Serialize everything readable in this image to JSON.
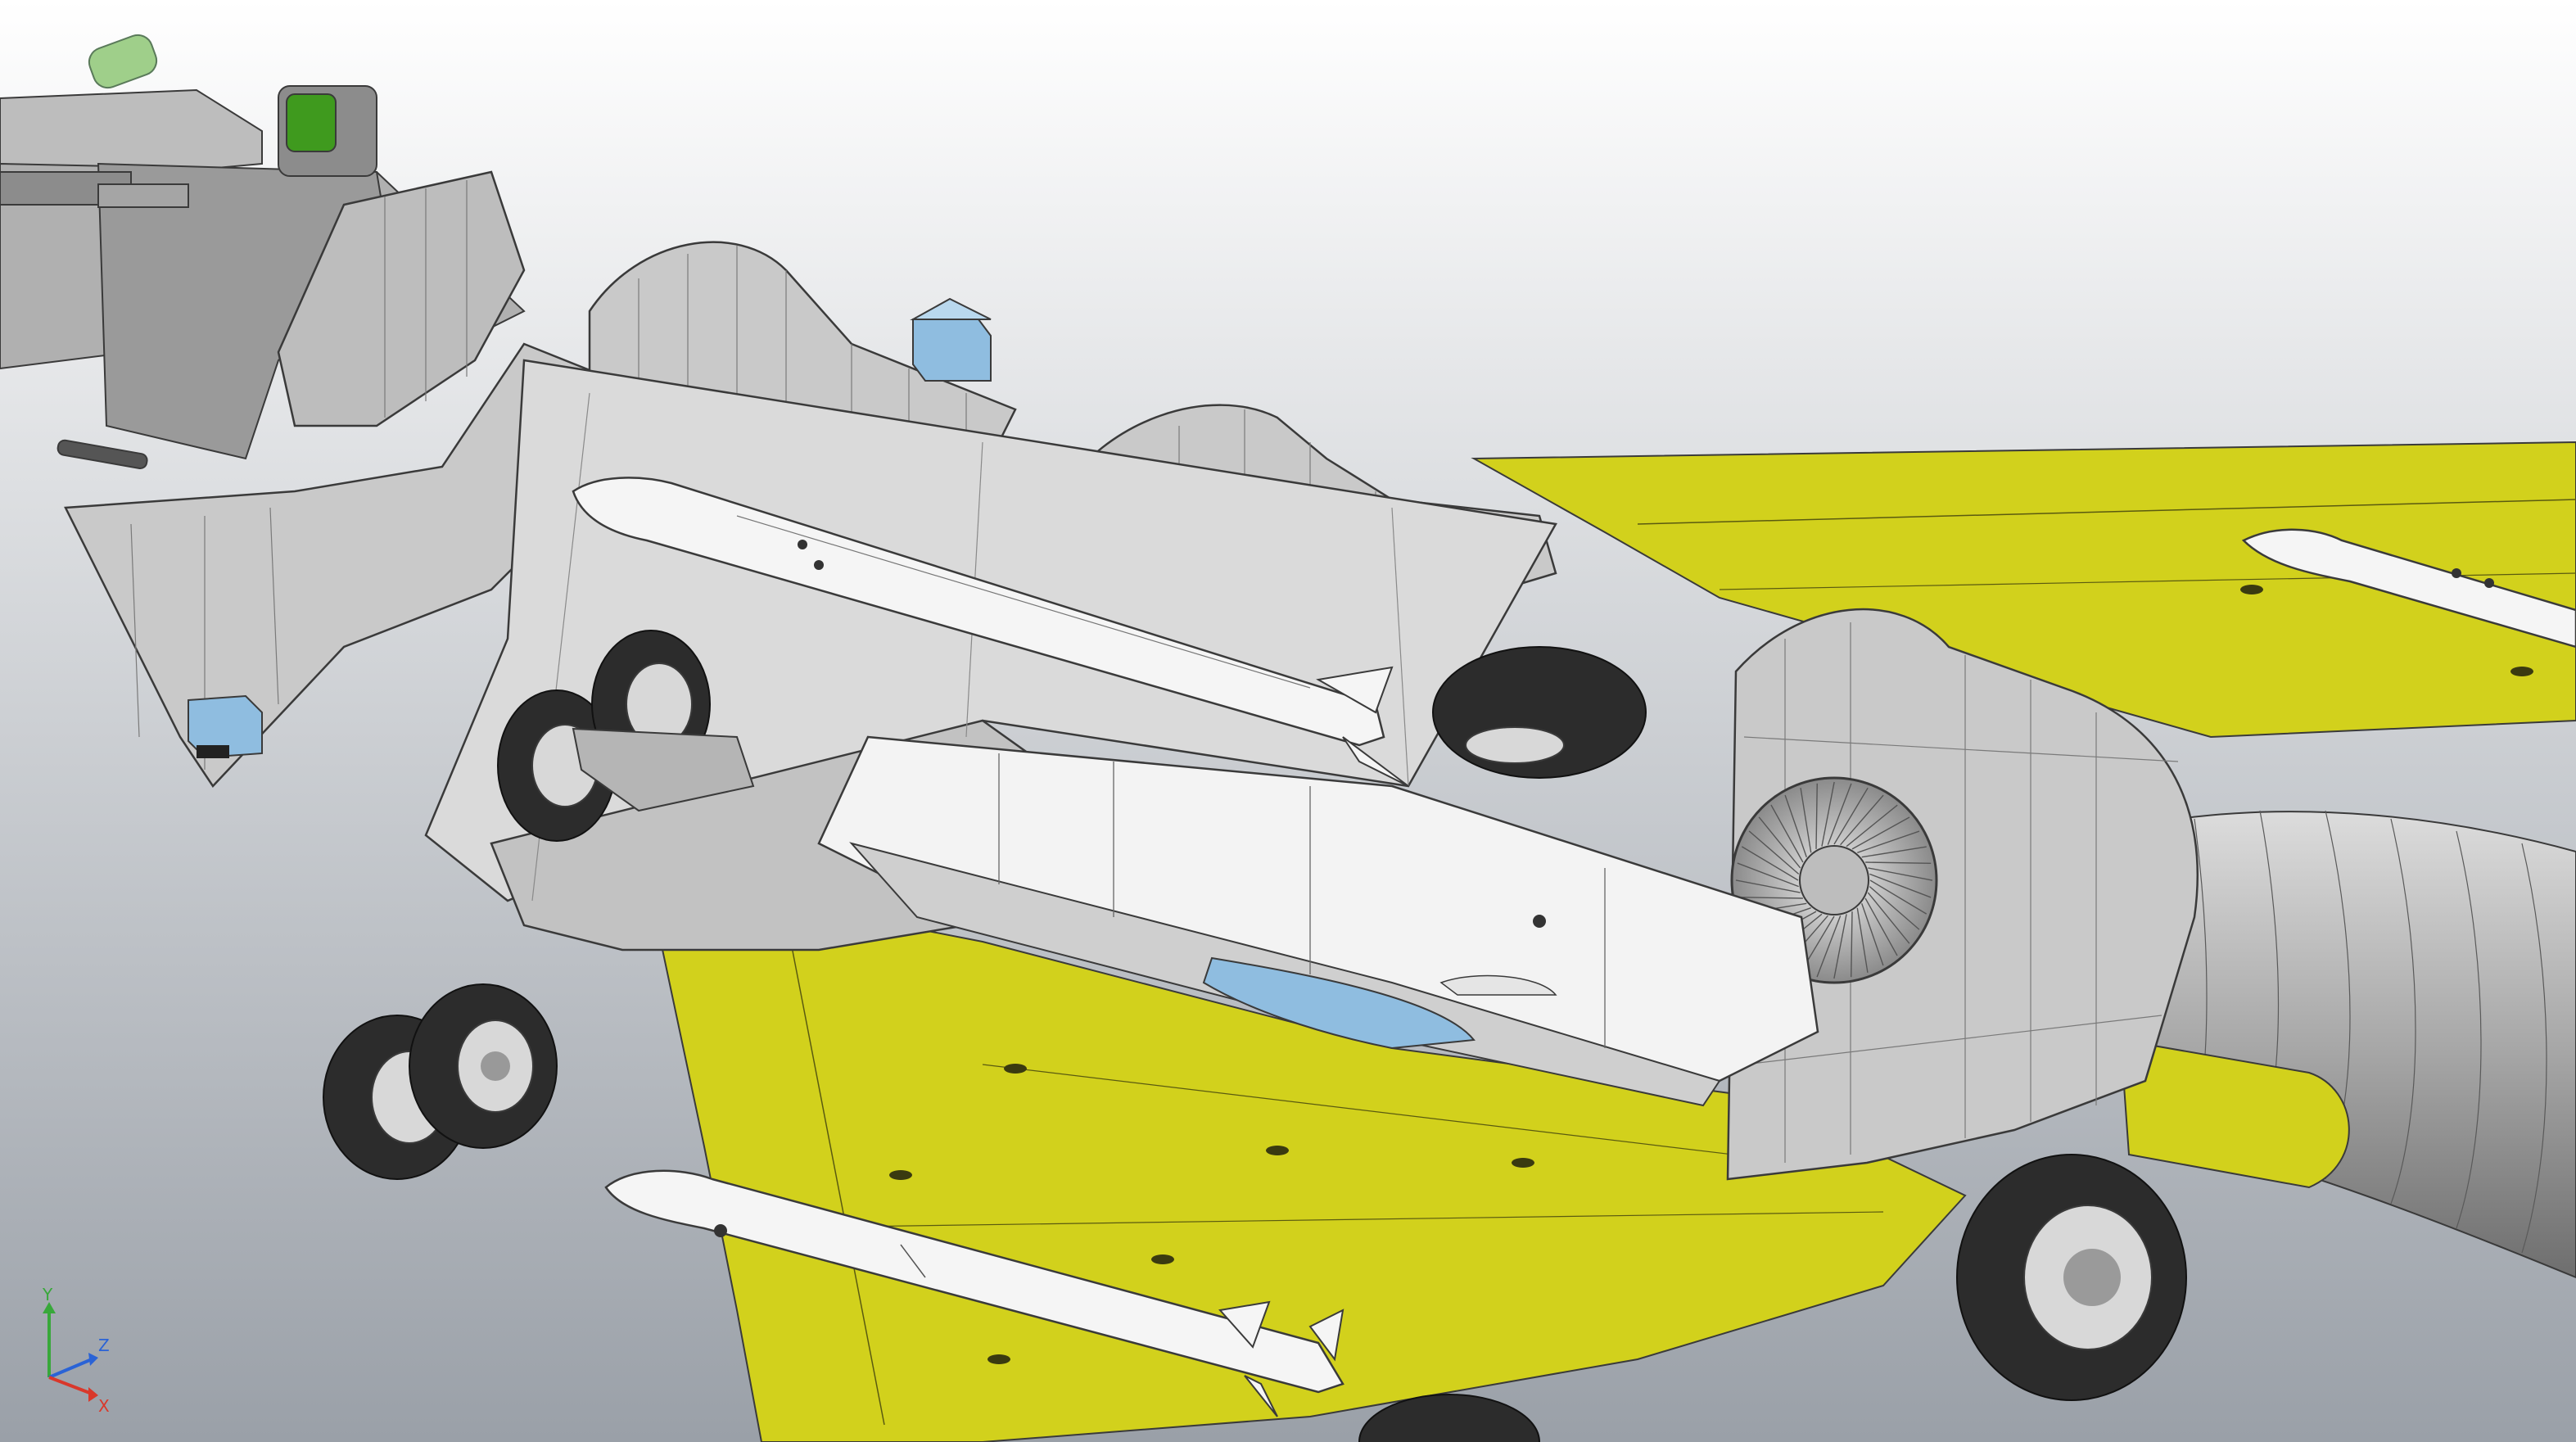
{
  "viewport": {
    "background_top": "#ffffff",
    "background_bottom": "#9aa0a8"
  },
  "colors": {
    "wing_yellow": "#d2d11c",
    "wing_yellow_dark": "#b5b418",
    "structure_gray": "#c9c9c9",
    "structure_dark": "#8c8c8c",
    "edge": "#3a3a3a",
    "missile_white": "#f5f5f5",
    "tire_dark": "#2c2c2c",
    "hub_light": "#d8d8d8",
    "blue_part": "#8fbde0",
    "green_part": "#3f9a1e"
  },
  "triad": {
    "x_label": "X",
    "y_label": "Y",
    "z_label": "Z",
    "x_color": "#d9382b",
    "y_color": "#38a83a",
    "z_color": "#2a63d6"
  }
}
